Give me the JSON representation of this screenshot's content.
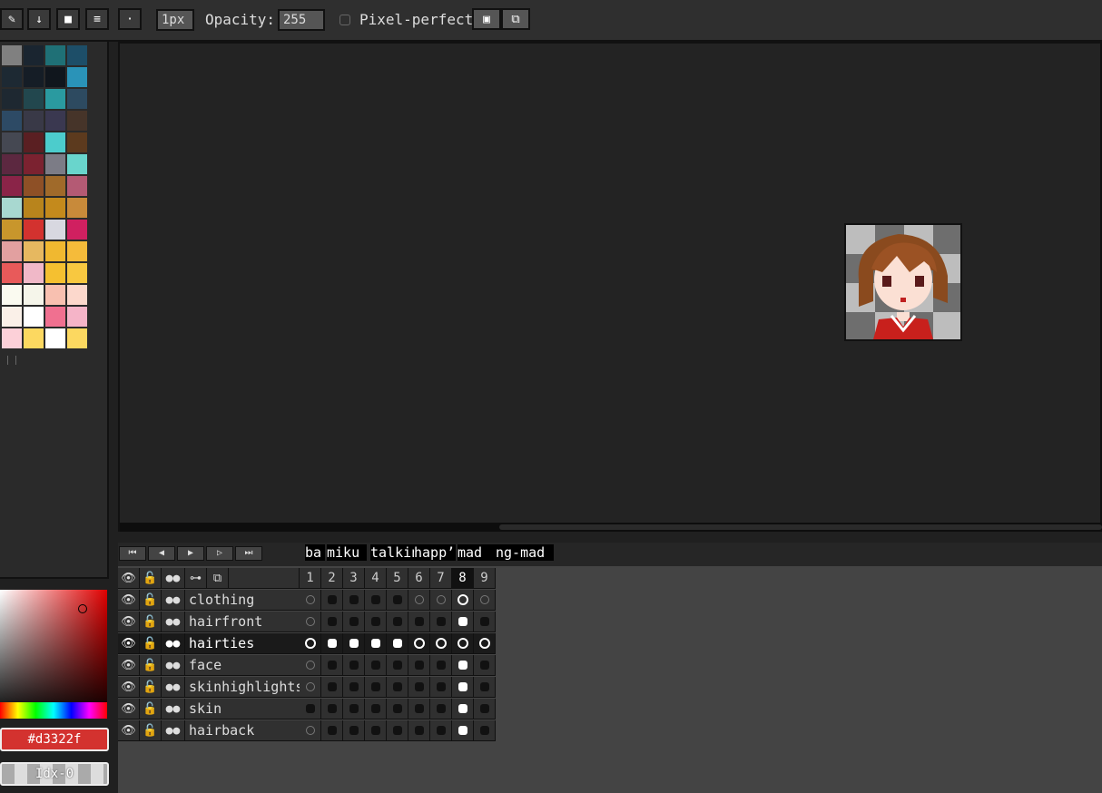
{
  "toolbar": {
    "brush_size": "1px",
    "opacity_label": "Opacity:",
    "opacity_value": "255",
    "pixel_perfect_label": "Pixel-perfect"
  },
  "palette": {
    "colors": [
      "#808080",
      "#1a2530",
      "#1f7076",
      "#1d4e68",
      "#1d2933",
      "#151d26",
      "#10161d",
      "#2a93b8",
      "#1e2831",
      "#22474e",
      "#2a9aa0",
      "#2d4a60",
      "#2d4a65",
      "#393947",
      "#3a3850",
      "#463429",
      "#454852",
      "#5a1f22",
      "#4ccccc",
      "#5c3a1e",
      "#5c2840",
      "#7b2230",
      "#7c7c86",
      "#69d5cc",
      "#8a2448",
      "#8e5026",
      "#a06a2a",
      "#b45a74",
      "#a8d8d0",
      "#b8841c",
      "#c48a1c",
      "#c88a3a",
      "#c8962c",
      "#d3322f",
      "#d8d8e0",
      "#d02060",
      "#e2a0a0",
      "#e6b860",
      "#f0b830",
      "#f5bb3a",
      "#e85a5a",
      "#f0b8c8",
      "#f5c030",
      "#f8c840",
      "#fafaf0",
      "#f5f5ea",
      "#f8c0b0",
      "#fcd8cc",
      "#faf0e8",
      "#ffffff",
      "#f07090",
      "#f5b4c8",
      "#fcd0d8",
      "#fcd860",
      "#ffffff",
      "#fcd860"
    ]
  },
  "timeline": {
    "tags": [
      "ba",
      "miku",
      "talkin",
      "happ’",
      "mad",
      "ng-mad"
    ],
    "frames": [
      "1",
      "2",
      "3",
      "4",
      "5",
      "6",
      "7",
      "8",
      "9"
    ],
    "active_frame": "8",
    "layers": [
      {
        "name": "clothing",
        "cells": [
          "r",
          "d",
          "d",
          "d",
          "d",
          "r",
          "r",
          "rw",
          "r"
        ]
      },
      {
        "name": "hairfront",
        "cells": [
          "r",
          "d",
          "d",
          "d",
          "d",
          "d",
          "d",
          "s",
          "d"
        ]
      },
      {
        "name": "hairties",
        "cells": [
          "rw",
          "s",
          "s",
          "s",
          "s",
          "rw",
          "rw",
          "rw",
          "rw"
        ]
      },
      {
        "name": "face",
        "cells": [
          "r",
          "d",
          "d",
          "d",
          "d",
          "d",
          "d",
          "s",
          "d"
        ]
      },
      {
        "name": "skinhighlights",
        "cells": [
          "r",
          "d",
          "d",
          "d",
          "d",
          "d",
          "d",
          "s",
          "d"
        ]
      },
      {
        "name": "skin",
        "cells": [
          "d",
          "d",
          "d",
          "d",
          "d",
          "d",
          "d",
          "s",
          "d"
        ]
      },
      {
        "name": "hairback",
        "cells": [
          "r",
          "d",
          "d",
          "d",
          "d",
          "d",
          "d",
          "s",
          "d"
        ]
      }
    ],
    "selected_layer": "hairties"
  },
  "color": {
    "hex": "#d3322f",
    "index_label": "Idx-0"
  },
  "icons": [
    "pencil-icon",
    "down-arrow-icon",
    "stop-icon",
    "menu-icon",
    "dot-icon",
    "eye-icon",
    "lock-icon",
    "link-icon"
  ]
}
